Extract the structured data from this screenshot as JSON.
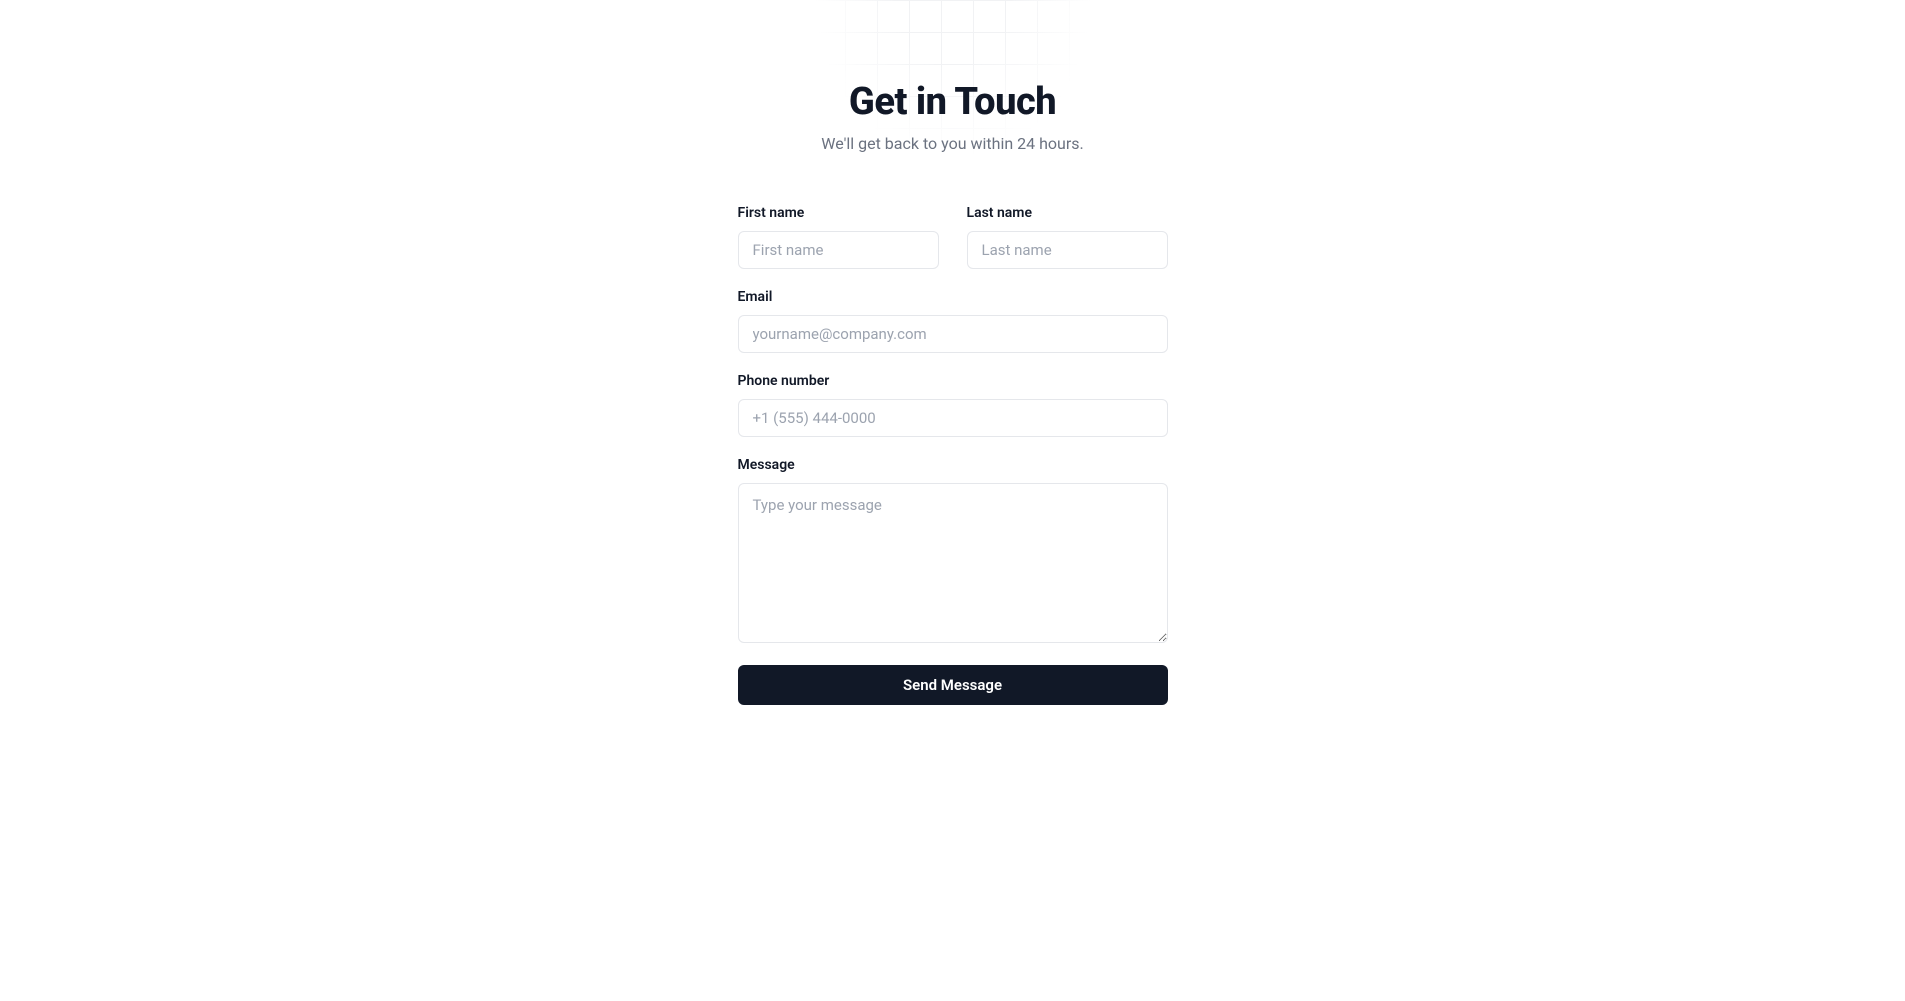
{
  "header": {
    "title": "Get in Touch",
    "subtitle": "We'll get back to you within 24 hours."
  },
  "form": {
    "firstName": {
      "label": "First name",
      "placeholder": "First name"
    },
    "lastName": {
      "label": "Last name",
      "placeholder": "Last name"
    },
    "email": {
      "label": "Email",
      "placeholder": "yourname@company.com"
    },
    "phone": {
      "label": "Phone number",
      "placeholder": "+1 (555) 444-0000"
    },
    "message": {
      "label": "Message",
      "placeholder": "Type your message"
    },
    "submitLabel": "Send Message"
  }
}
